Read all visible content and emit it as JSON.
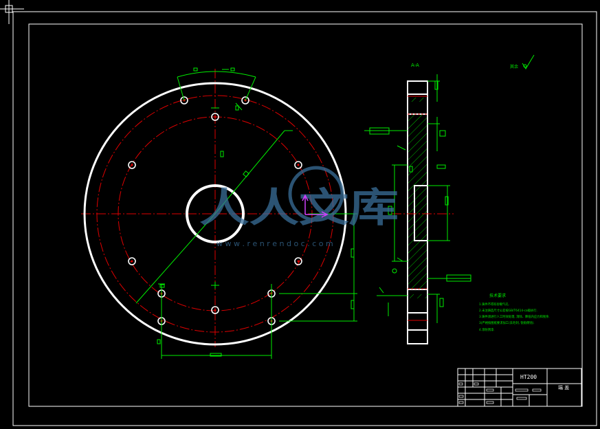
{
  "app": {
    "title": "CAD drawing"
  },
  "colors": {
    "background": "#000000",
    "frame": "#ffffff",
    "part": "#ffffff",
    "centerline": "#e00000",
    "dimension": "#00ee00",
    "hatch": "#00ee00",
    "watermark": "#3a6f9a",
    "ucs": "#d040ff"
  },
  "watermark": {
    "brand": "人人文库",
    "url": "w w w . r e n r e n d o c . c o m"
  },
  "title_block": {
    "material": "HT200",
    "part_name": "端 盖"
  },
  "tech_requirements": {
    "heading": "技术要求",
    "items": [
      "1.铸件不得有砂眼气孔.",
      "2.未注铸造尺寸公差按GB/T6414-ca级执行.",
      "3.铸件须进行人工时效处理, 消除、降低内应力和残余.",
      "3)严格按图纸要求加工(去毛刺, 锐角倒钝).",
      "4.涂防锈漆."
    ]
  },
  "roughness": {
    "other_label": "其余"
  },
  "section_label": "A-A"
}
